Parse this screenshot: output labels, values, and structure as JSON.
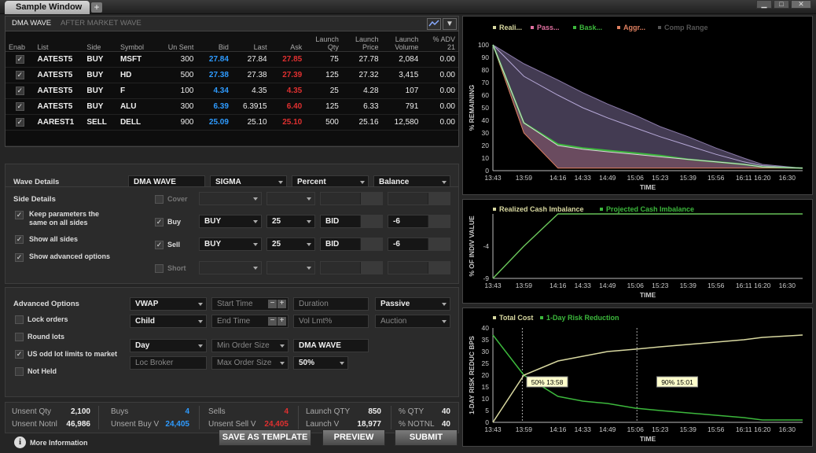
{
  "window": {
    "tab_title": "Sample Window",
    "add_tab": "+",
    "min": "▁",
    "max": "□",
    "close": "✕"
  },
  "order_table": {
    "tabs": [
      "DMA WAVE",
      "AFTER MARKET WAVE"
    ],
    "chart_icon": "chart-icon",
    "filter_icon": "filter-icon",
    "columns": [
      "Enab",
      "List",
      "Side",
      "Symbol",
      "Un Sent",
      "Bid",
      "Last",
      "Ask",
      "Launch\nQty",
      "Launch\nPrice",
      "Launch\nVolume",
      "% ADV\n21"
    ],
    "rows": [
      {
        "enab": "✓",
        "list": "AATEST5",
        "side": "BUY",
        "symbol": "MSFT",
        "unsent": "300",
        "bid": "27.84",
        "last": "27.84",
        "ask": "27.85",
        "lqty": "75",
        "lprice": "27.78",
        "lvol": "2,084",
        "adv": "0.00"
      },
      {
        "enab": "✓",
        "list": "AATEST5",
        "side": "BUY",
        "symbol": "HD",
        "unsent": "500",
        "bid": "27.38",
        "last": "27.38",
        "ask": "27.39",
        "lqty": "125",
        "lprice": "27.32",
        "lvol": "3,415",
        "adv": "0.00"
      },
      {
        "enab": "✓",
        "list": "AATEST5",
        "side": "BUY",
        "symbol": "F",
        "unsent": "100",
        "bid": "4.34",
        "last": "4.35",
        "ask": "4.35",
        "lqty": "25",
        "lprice": "4.28",
        "lvol": "107",
        "adv": "0.00"
      },
      {
        "enab": "✓",
        "list": "AATEST5",
        "side": "BUY",
        "symbol": "ALU",
        "unsent": "300",
        "bid": "6.39",
        "last": "6.3915",
        "ask": "6.40",
        "lqty": "125",
        "lprice": "6.33",
        "lvol": "791",
        "adv": "0.00"
      },
      {
        "enab": "✓",
        "list": "AAREST1",
        "side": "SELL",
        "symbol": "DELL",
        "unsent": "900",
        "bid": "25.09",
        "last": "25.10",
        "ask": "25.10",
        "lqty": "500",
        "lprice": "25.16",
        "lvol": "12,580",
        "adv": "0.00"
      }
    ]
  },
  "wave": {
    "label": "Wave Details",
    "strategy": "DMA WAVE",
    "model": "SIGMA",
    "unit": "Percent",
    "mode": "Balance"
  },
  "side": {
    "label": "Side Details",
    "opt_keep": "Keep parameters the same on all sides",
    "opt_keep_1": "Keep parameters the",
    "opt_keep_2": "same on all sides",
    "opt_show_all": "Show all sides",
    "opt_show_adv": "Show advanced options",
    "cover": "Cover",
    "buy": "Buy",
    "sell": "Sell",
    "short": "Short",
    "buy_side": "BUY",
    "buy_pct": "25",
    "buy_ref": "BID",
    "buy_off": "-6",
    "sell_side": "BUY",
    "sell_pct": "25",
    "sell_ref": "BID",
    "sell_off": "-6"
  },
  "advanced": {
    "label": "Advanced Options",
    "lock": "Lock orders",
    "round": "Round lots",
    "odd": "US odd lot limits to market",
    "not_held": "Not Held",
    "algo": "VWAP",
    "start_time": "Start Time",
    "duration": "Duration",
    "style": "Passive",
    "child": "Child",
    "end_time": "End Time",
    "vol_lmt": "Vol Lmt%",
    "auction": "Auction",
    "tif": "Day",
    "min_order": "Min Order Size",
    "dest": "DMA WAVE",
    "loc_broker": "Loc Broker",
    "max_order": "Max Order Size",
    "max_pct": "50%"
  },
  "summary": {
    "unsent_qty_l": "Unsent Qty",
    "unsent_qty": "2,100",
    "unsent_notl_l": "Unsent Notnl",
    "unsent_notl": "46,986",
    "buys_l": "Buys",
    "buys": "4",
    "unsent_buy_l": "Unsent Buy V",
    "unsent_buy": "24,405",
    "sells_l": "Sells",
    "sells": "4",
    "unsent_sell_l": "Unsent Sell V",
    "unsent_sell": "24,405",
    "launch_qty_l": "Launch QTY",
    "launch_qty": "850",
    "launch_v_l": "Launch V",
    "launch_v": "18,977",
    "pct_qty_l": "% QTY",
    "pct_qty": "40",
    "pct_notnl_l": "% NOTNL",
    "pct_notnl": "40"
  },
  "footer": {
    "info": "More Information",
    "save": "SAVE AS TEMPLATE",
    "preview": "PREVIEW",
    "submit": "SUBMIT"
  },
  "colors": {
    "buy_blue": "#2e9bff",
    "ask_red": "#e03030",
    "olive": "#d8d8a0",
    "green": "#3cb83c",
    "pink": "#e070a0",
    "salmon": "#e08060"
  },
  "chart_data": [
    {
      "type": "area",
      "xlabel": "TIME",
      "ylabel": "% REMAINING",
      "ylim": [
        0,
        100
      ],
      "x": [
        "13:43",
        "13:59",
        "14:16",
        "14:33",
        "14:49",
        "15:06",
        "15:23",
        "15:39",
        "15:56",
        "16:11",
        "16:20",
        "16:30"
      ],
      "legend": [
        "Reali...",
        "Pass...",
        "Bask...",
        "Aggr...",
        "Comp Range"
      ],
      "series": [
        {
          "name": "Reali...",
          "values": [
            100,
            38,
            20,
            17,
            15,
            13,
            11,
            9,
            7,
            5,
            3,
            2
          ]
        },
        {
          "name": "Pass...",
          "values": [
            100,
            75,
            60,
            50,
            42,
            34,
            27,
            20,
            13,
            7,
            4,
            2
          ]
        },
        {
          "name": "Bask...",
          "values": [
            100,
            38,
            21,
            18,
            16,
            14,
            12,
            9,
            7,
            5,
            3,
            2
          ]
        },
        {
          "name": "Aggr...",
          "values": [
            100,
            30,
            2,
            2,
            2,
            2,
            2,
            2,
            2,
            2,
            2,
            2
          ]
        },
        {
          "name": "Comp Range",
          "values": [
            100,
            85,
            72,
            62,
            53,
            44,
            35,
            27,
            18,
            10,
            5,
            2
          ]
        }
      ]
    },
    {
      "type": "line",
      "xlabel": "TIME",
      "ylabel": "% OF INDIV VALUE",
      "yticks": [
        -9,
        -4,
        1
      ],
      "x": [
        "13:43",
        "13:59",
        "14:16",
        "14:33",
        "14:49",
        "15:06",
        "15:23",
        "15:39",
        "15:56",
        "16:11",
        "16:20",
        "16:30"
      ],
      "legend": [
        "Realized Cash Imbalance",
        "Projected Cash Imbalance"
      ],
      "series": [
        {
          "name": "Realized Cash Imbalance",
          "values": [
            -9,
            -4,
            1,
            1,
            1,
            1,
            1,
            1,
            1,
            1,
            1,
            1
          ]
        },
        {
          "name": "Projected Cash Imbalance",
          "values": [
            -9,
            -4,
            1,
            1,
            1,
            1,
            1,
            1,
            1,
            1,
            1,
            1
          ]
        }
      ]
    },
    {
      "type": "line",
      "xlabel": "TIME",
      "ylabel": "1-DAY RISK REDUC BPS",
      "ylim": [
        0,
        40
      ],
      "x": [
        "13:43",
        "13:59",
        "14:16",
        "14:33",
        "14:49",
        "15:06",
        "15:23",
        "15:39",
        "15:56",
        "16:11",
        "16:20",
        "16:30"
      ],
      "legend": [
        "Total Cost",
        "1-Day Risk Reduction"
      ],
      "annotations": [
        "50% 13:58",
        "90% 15:01"
      ],
      "series": [
        {
          "name": "Total Cost",
          "values": [
            0,
            20,
            26,
            28,
            30,
            31,
            32,
            33,
            34,
            35,
            36,
            37
          ]
        },
        {
          "name": "1-Day Risk Reduction",
          "values": [
            37,
            20,
            11,
            9,
            8,
            6,
            5,
            4,
            3,
            2,
            1,
            1
          ]
        }
      ]
    }
  ]
}
